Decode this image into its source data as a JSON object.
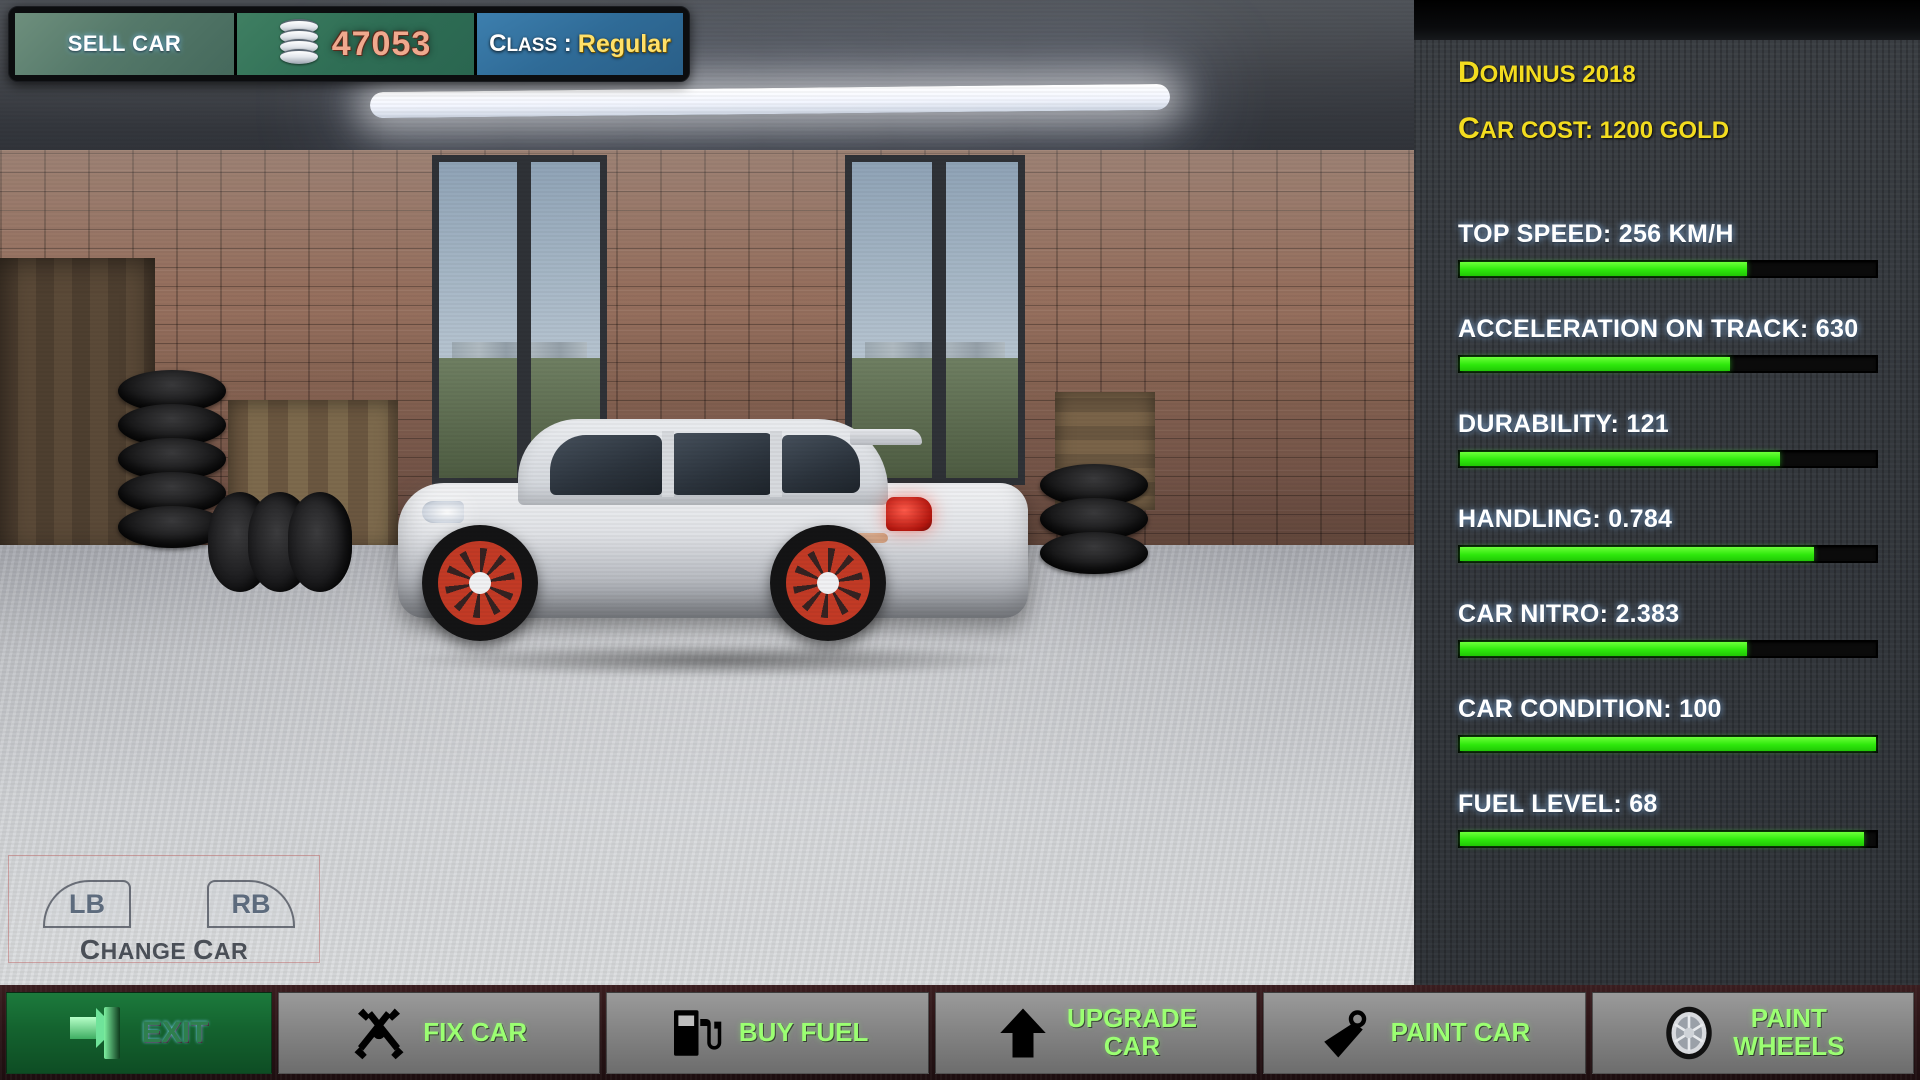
{
  "hud": {
    "sell_car_label": "SELL CAR",
    "gold_amount": "47053",
    "gold_icon": "coin-stack-icon",
    "class_label_first": "C",
    "class_label_rest": "LASS",
    "class_separator": " : ",
    "class_value": "Regular"
  },
  "change_car": {
    "left_bumper": "LB",
    "right_bumper": "RB",
    "label_c1": "C",
    "label_r1": "HANGE ",
    "label_c2": "C",
    "label_r2": "AR",
    "full_label": "CHANGE CAR"
  },
  "panel": {
    "car_name_first": "D",
    "car_name_rest": "OMINUS 2018",
    "car_name": "Dominus 2018",
    "car_cost_first": "C",
    "car_cost_rest": "AR COST: 1200 G",
    "car_cost_tail": "OLD",
    "car_cost": "Car cost: 1200 Gold"
  },
  "chart_data": {
    "type": "bar",
    "title": "Car Statistics",
    "orientation": "horizontal",
    "categories": [
      "TOP SPEED",
      "ACCELERATION ON TRACK",
      "DURABILITY",
      "HANDLING",
      "CAR NITRO",
      "CAR CONDITION",
      "FUEL LEVEL"
    ],
    "values": [
      256,
      630,
      121,
      0.784,
      2.383,
      100,
      68
    ],
    "units": [
      "KM/H",
      "",
      "",
      "",
      "",
      "",
      ""
    ],
    "fill_percent": [
      69,
      65,
      77,
      85,
      69,
      100,
      97
    ],
    "bar_color": "#2ee80c",
    "track_color": "#0b0b0b",
    "grid": false,
    "legend": false
  },
  "stats": [
    {
      "label": "TOP SPEED: 256 KM/H",
      "percent": 69
    },
    {
      "label": "ACCELERATION ON TRACK: 630",
      "percent": 65
    },
    {
      "label": "DURABILITY: 121",
      "percent": 77
    },
    {
      "label": "HANDLING: 0.784",
      "percent": 85
    },
    {
      "label": "CAR NITRO: 2.383",
      "percent": 69
    },
    {
      "label": "CAR CONDITION: 100",
      "percent": 100
    },
    {
      "label": "FUEL LEVEL: 68",
      "percent": 97
    }
  ],
  "toolbar": {
    "buttons": [
      {
        "label": "EXIT",
        "icon": "exit-door-icon",
        "active": true
      },
      {
        "label": "FIX CAR",
        "icon": "crossed-wrenches-icon",
        "active": false
      },
      {
        "label": "BUY FUEL",
        "icon": "fuel-pump-icon",
        "active": false
      },
      {
        "label": "UPGRADE CAR",
        "icon": "up-arrow-icon",
        "active": false
      },
      {
        "label": "PAINT CAR",
        "icon": "paint-brush-icon",
        "active": false
      },
      {
        "label": "PAINT WHEELS",
        "icon": "alloy-wheel-icon",
        "active": false
      }
    ]
  },
  "colors": {
    "accent_yellow": "#f3dc1f",
    "bar_green": "#2ee80c",
    "toolbar_text_green": "#9bff72",
    "gold_text": "#f0a98e",
    "class_value": "#ffe069",
    "panel_bg": "#34383d"
  }
}
